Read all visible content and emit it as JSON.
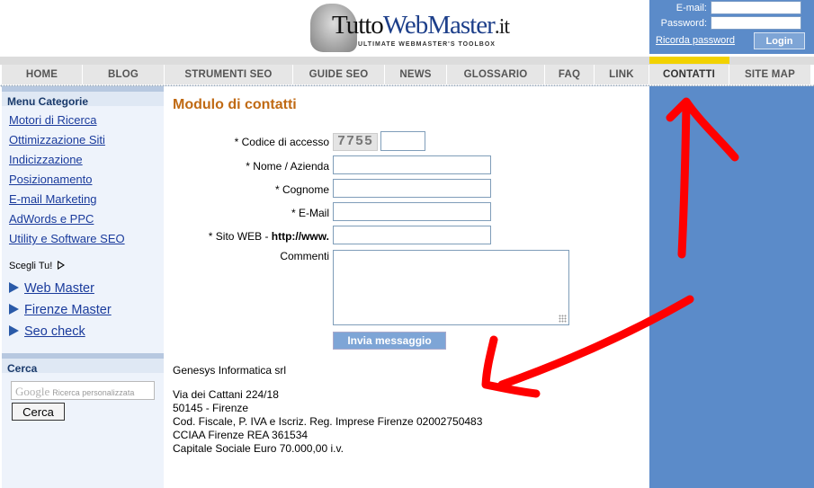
{
  "header": {
    "logo": {
      "name_main": "Tutto",
      "name_accent": "WebMaster",
      "name_suffix": ".it",
      "tagline": "ULTIMATE WEBMASTER'S TOOLBOX"
    },
    "login": {
      "email_label": "E-mail:",
      "password_label": "Password:",
      "remember_label": "Ricorda password",
      "login_button": "Login"
    }
  },
  "nav": {
    "tabs": [
      "HOME",
      "BLOG",
      "STRUMENTI SEO",
      "GUIDE SEO",
      "NEWS",
      "GLOSSARIO",
      "FAQ",
      "LINK",
      "CONTATTI",
      "SITE MAP"
    ],
    "active": "CONTATTI"
  },
  "sidebar": {
    "categories_title": "Menu Categorie",
    "categories": [
      "Motori di Ricerca",
      "Ottimizzazione Siti",
      "Indicizzazione",
      "Posizionamento",
      "E-mail Marketing",
      "AdWords e PPC",
      "Utility e Software SEO"
    ],
    "choose_label": "Scegli Tu!",
    "sites": [
      "Web Master",
      "Firenze Master",
      "Seo check"
    ],
    "search_title": "Cerca",
    "search_placeholder_brand": "Google",
    "search_placeholder": "Ricerca personalizzata",
    "search_button": "Cerca"
  },
  "form": {
    "title": "Modulo di contatti",
    "captcha_label": "* Codice di accesso",
    "captcha_code": "7755",
    "name_label": "* Nome / Azienda",
    "surname_label": "* Cognome",
    "email_label": "* E-Mail",
    "website_label": "* Sito WEB - ",
    "website_prefix": "http://www.",
    "comments_label": "Commenti",
    "submit_label": "Invia messaggio"
  },
  "company": {
    "name": "Genesys Informatica srl",
    "address_lines": [
      "Via dei Cattani 224/18",
      "50145 - Firenze",
      "Cod. Fiscale, P. IVA e Iscriz. Reg. Imprese Firenze 02002750483",
      "CCIAA Firenze REA 361534",
      "Capitale Sociale Euro 70.000,00 i.v."
    ]
  },
  "colors": {
    "blue_panel": "#5b8bc9",
    "title_orange": "#c06a14",
    "active_tab_bar": "#f2d200",
    "annotation_red": "#ff0000"
  },
  "annotations": [
    "red-arrow-up-to-contatti",
    "red-arrow-down-left-to-company-info"
  ]
}
